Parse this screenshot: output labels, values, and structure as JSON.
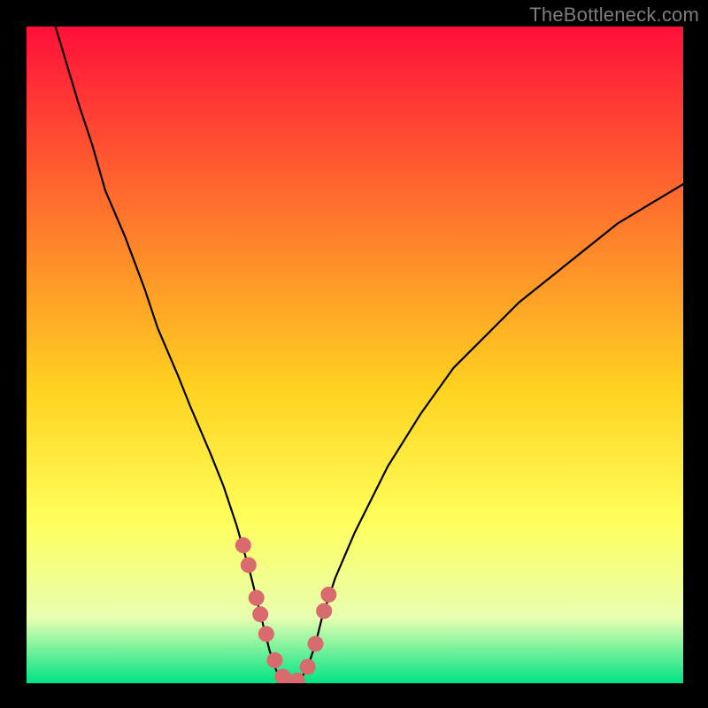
{
  "watermark": "TheBottleneck.com",
  "colors": {
    "bg_black": "#000000",
    "grad_top": "#ff1038",
    "grad_mid1": "#ff7a2c",
    "grad_mid2": "#ffd21f",
    "grad_mid3": "#ffff5a",
    "grad_mid4": "#e8ffb0",
    "grad_bottom": "#00e385",
    "curve": "#000000",
    "highlight": "#d96a6d"
  },
  "chart_data": {
    "type": "line",
    "title": "",
    "xlabel": "",
    "ylabel": "",
    "xlim": [
      0,
      100
    ],
    "ylim": [
      0,
      100
    ],
    "x": [
      0,
      2,
      5,
      8,
      10,
      12,
      15,
      18,
      20,
      23,
      25,
      28,
      30,
      32,
      34,
      35,
      36,
      37,
      38,
      39,
      40,
      41,
      42,
      43,
      44,
      45,
      47,
      50,
      55,
      60,
      65,
      70,
      75,
      80,
      85,
      90,
      95,
      100
    ],
    "values": [
      115,
      108,
      98,
      88,
      82,
      75,
      68,
      60,
      54,
      47,
      42,
      35,
      30,
      24,
      17,
      13,
      9,
      5,
      2,
      0,
      0,
      0,
      1,
      3,
      6,
      10,
      16,
      23,
      33,
      41,
      48,
      53,
      58,
      62,
      66,
      70,
      73,
      76
    ],
    "highlight_points": {
      "x": [
        33.0,
        33.8,
        35.0,
        35.6,
        36.5,
        37.8,
        39.0,
        40.0,
        41.2,
        42.8,
        44.0,
        45.3,
        46.0
      ],
      "y": [
        21.0,
        18.0,
        13.0,
        10.5,
        7.5,
        3.5,
        1.0,
        0.2,
        0.4,
        2.5,
        6.0,
        11.0,
        13.5
      ]
    }
  }
}
